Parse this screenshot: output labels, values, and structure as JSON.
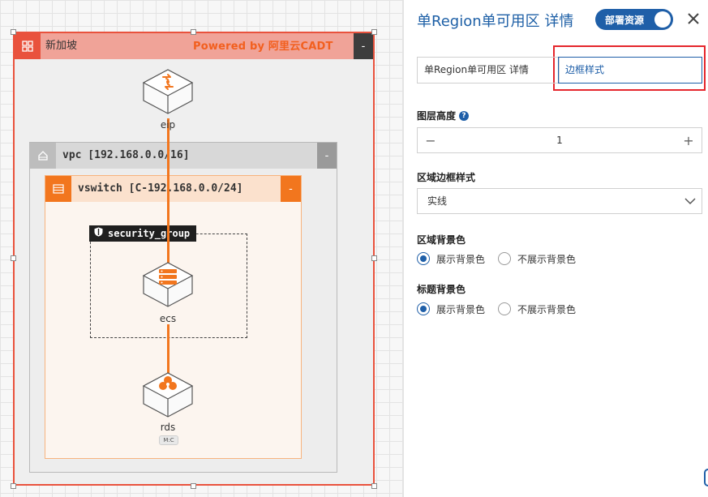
{
  "canvas": {
    "region": {
      "title": "新加坡",
      "collapse": "-",
      "powered_by": "Powered by 阿里云CADT"
    },
    "vpc": {
      "title": "vpc [192.168.0.0/16]",
      "collapse": "-"
    },
    "vswitch": {
      "title": "vswitch [C-192.168.0.0/24]",
      "collapse": "-"
    },
    "security_group": {
      "title": "security_group"
    },
    "nodes": {
      "eip": {
        "label": "eip",
        "icon": "eip-icon"
      },
      "ecs": {
        "label": "ecs",
        "icon": "ecs-server-icon"
      },
      "rds": {
        "label": "rds",
        "icon": "rds-database-icon",
        "badge": "M:C"
      }
    },
    "colors": {
      "region": "#e9523d",
      "vswitch": "#f2761e",
      "connector": "#f2761e",
      "accent": "#1f5fa8"
    }
  },
  "panel": {
    "title": "单Region单可用区 详情",
    "deploy_toggle": {
      "label": "部署资源",
      "on": true
    },
    "tabs": [
      {
        "label": "单Region单可用区 详情",
        "active": false
      },
      {
        "label": "边框样式",
        "active": true
      }
    ],
    "layer_height": {
      "label": "图层高度",
      "value": "1",
      "minus": "−",
      "plus": "+"
    },
    "border_style": {
      "label": "区域边框样式",
      "value": "实线"
    },
    "area_background": {
      "label": "区域背景色",
      "options": [
        {
          "label": "展示背景色",
          "checked": true
        },
        {
          "label": "不展示背景色",
          "checked": false
        }
      ]
    },
    "title_background": {
      "label": "标题背景色",
      "options": [
        {
          "label": "展示背景色",
          "checked": true
        },
        {
          "label": "不展示背景色",
          "checked": false
        }
      ]
    }
  }
}
